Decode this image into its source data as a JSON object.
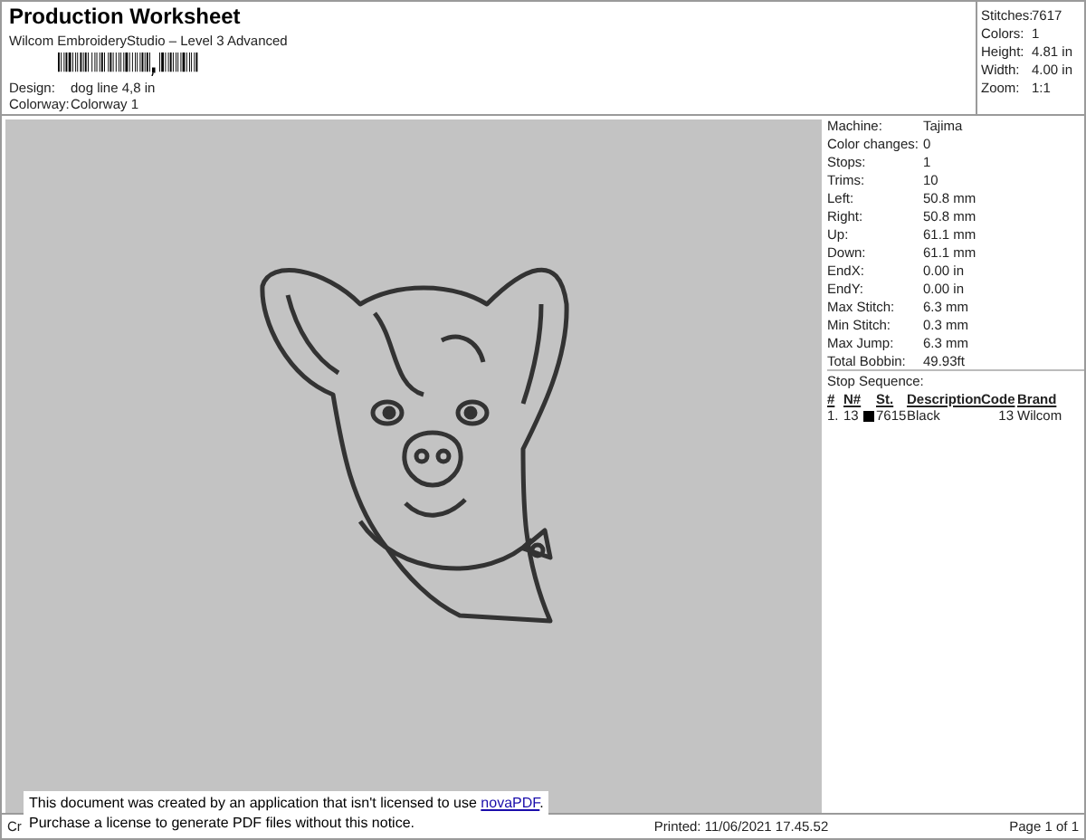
{
  "header": {
    "title": "Production Worksheet",
    "subtitle": "Wilcom EmbroideryStudio – Level 3 Advanced",
    "fields": [
      {
        "label": "Design:",
        "value": "dog line 4,8 in"
      },
      {
        "label": "Colorway:",
        "value": "Colorway 1"
      }
    ]
  },
  "summary": [
    {
      "label": "Stitches:",
      "value": "7617"
    },
    {
      "label": "Colors:",
      "value": "1"
    },
    {
      "label": "Height:",
      "value": "4.81 in"
    },
    {
      "label": "Width:",
      "value": "4.00 in"
    },
    {
      "label": "Zoom:",
      "value": "1:1"
    }
  ],
  "details": [
    {
      "label": "Machine:",
      "value": "Tajima"
    },
    {
      "label": "Color changes:",
      "value": "0"
    },
    {
      "label": "Stops:",
      "value": "1"
    },
    {
      "label": "Trims:",
      "value": "10"
    },
    {
      "label": "Left:",
      "value": "50.8 mm"
    },
    {
      "label": "Right:",
      "value": "50.8 mm"
    },
    {
      "label": "Up:",
      "value": "61.1 mm"
    },
    {
      "label": "Down:",
      "value": "61.1 mm"
    },
    {
      "label": "EndX:",
      "value": "0.00 in"
    },
    {
      "label": "EndY:",
      "value": "0.00 in"
    },
    {
      "label": "Max Stitch:",
      "value": "6.3 mm"
    },
    {
      "label": "Min Stitch:",
      "value": "0.3 mm"
    },
    {
      "label": "Max Jump:",
      "value": "6.3 mm"
    },
    {
      "label": "Total Bobbin:",
      "value": "49.93ft"
    }
  ],
  "stop_sequence": {
    "title": "Stop Sequence:",
    "columns": [
      "#",
      "N#",
      "St.",
      "Description",
      "Code",
      "Brand"
    ],
    "rows": [
      {
        "index": "1.",
        "needle": "13",
        "color": "#000000",
        "stitches": "7615",
        "description": "Black",
        "code": "13",
        "brand": "Wilcom"
      }
    ]
  },
  "footer": {
    "left": "Cr",
    "printed": "Printed: 11/06/2021 17.45.52",
    "page": "Page 1 of 1"
  },
  "notice": {
    "text": "This document was created by an application that isn't licensed to use ",
    "link": "novaPDF",
    "period": ".",
    "line2": "Purchase a license to generate PDF files without this notice."
  }
}
